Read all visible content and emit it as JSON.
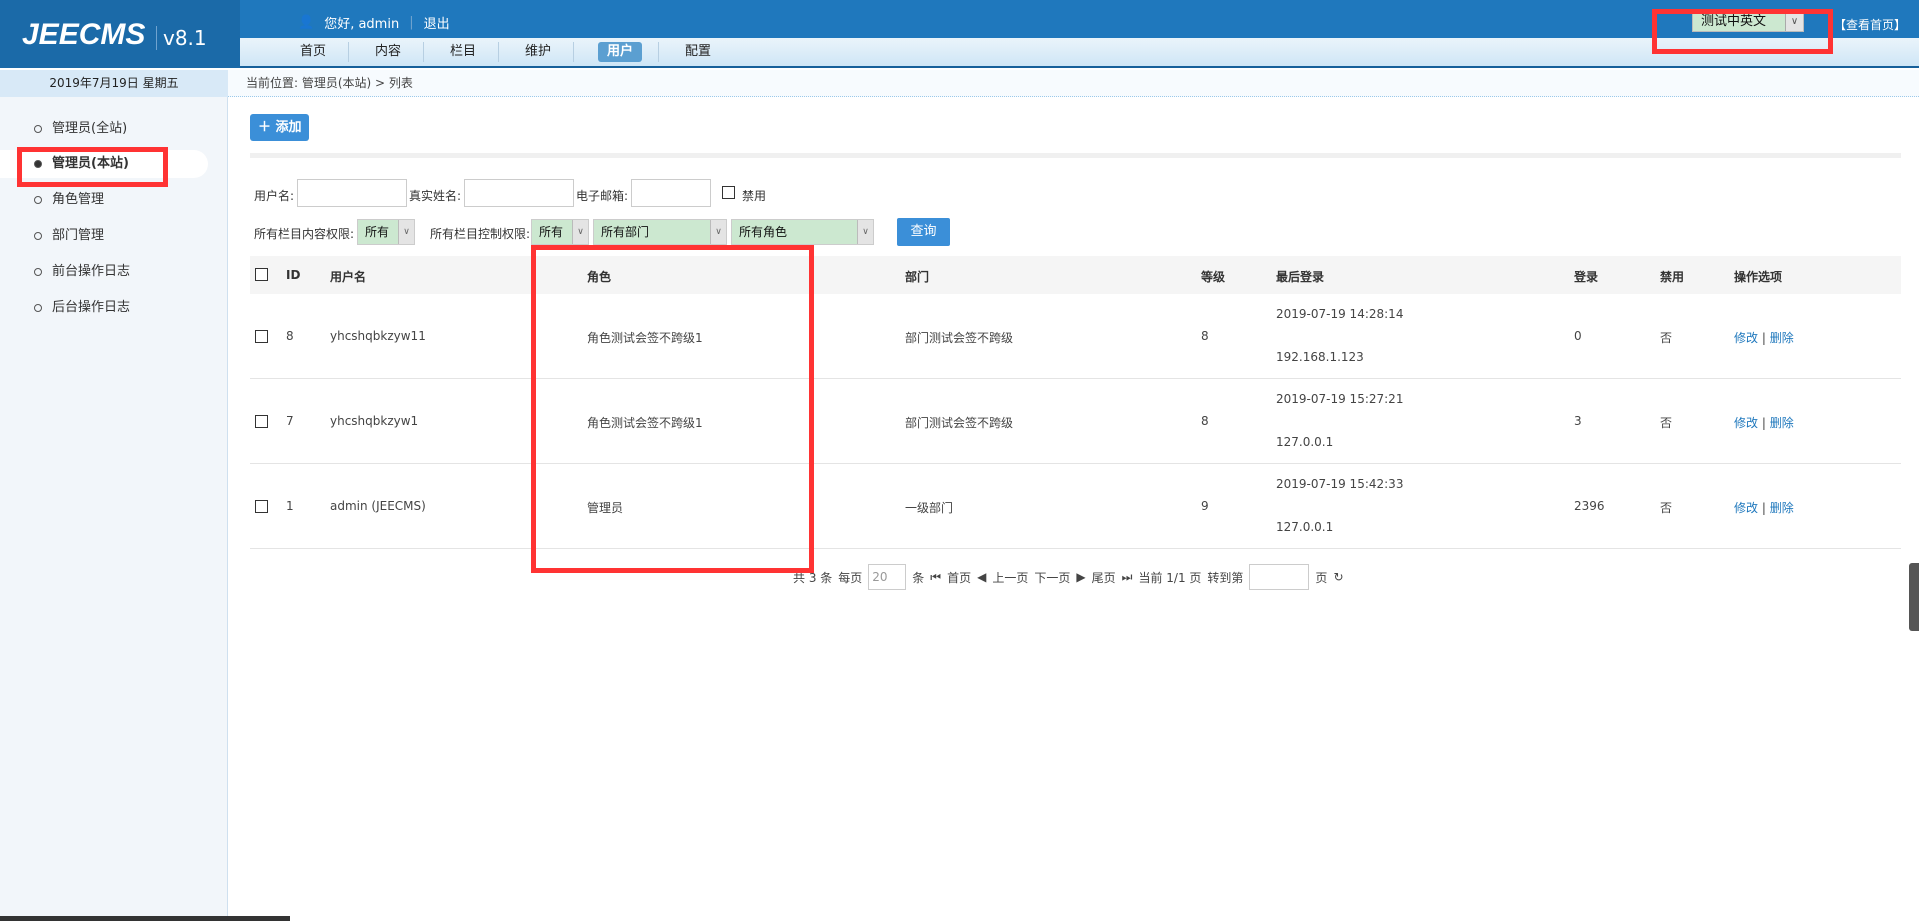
{
  "header": {
    "logo": "JEECMS",
    "version": "v8.1",
    "welcome": "您好, admin",
    "logout": "退出",
    "nav": [
      "首页",
      "内容",
      "栏目",
      "维护",
      "用户",
      "配置"
    ],
    "active_nav": "用户",
    "site_select": "测试中英文",
    "view_home": "【查看首页】"
  },
  "date": "2019年7月19日 星期五",
  "breadcrumb": "当前位置: 管理员(本站) > 列表",
  "sidebar": {
    "items": [
      {
        "label": "管理员(全站)"
      },
      {
        "label": "管理员(本站)",
        "active": true
      },
      {
        "label": "角色管理"
      },
      {
        "label": "部门管理"
      },
      {
        "label": "前台操作日志"
      },
      {
        "label": "后台操作日志"
      }
    ]
  },
  "toolbar": {
    "add": "添加"
  },
  "filters": {
    "username": "用户名:",
    "realname": "真实姓名:",
    "email": "电子邮箱:",
    "disabled": "禁用",
    "content_perm": "所有栏目内容权限:",
    "content_perm_value": "所有",
    "control_perm": "所有栏目控制权限:",
    "control_perm_value": "所有",
    "dept": "所有部门",
    "role": "所有角色",
    "query": "查询"
  },
  "table": {
    "headers": [
      "ID",
      "用户名",
      "角色",
      "部门",
      "等级",
      "最后登录",
      "登录",
      "禁用",
      "操作选项"
    ],
    "rows": [
      {
        "id": "8",
        "username": "yhcshqbkzyw11",
        "role": "角色测试会签不跨级1",
        "dept": "部门测试会签不跨级",
        "level": "8",
        "last_time": "2019-07-19 14:28:14",
        "last_ip": "192.168.1.123",
        "logins": "0",
        "disabled": "否"
      },
      {
        "id": "7",
        "username": "yhcshqbkzyw1",
        "role": "角色测试会签不跨级1",
        "dept": "部门测试会签不跨级",
        "level": "8",
        "last_time": "2019-07-19 15:27:21",
        "last_ip": "127.0.0.1",
        "logins": "3",
        "disabled": "否"
      },
      {
        "id": "1",
        "username": "admin (JEECMS)",
        "role": "管理员",
        "dept": "一级部门",
        "level": "9",
        "last_time": "2019-07-19 15:42:33",
        "last_ip": "127.0.0.1",
        "logins": "2396",
        "disabled": "否"
      }
    ],
    "edit": "修改",
    "sep": "|",
    "delete": "删除"
  },
  "pager": {
    "total": "共 3 条",
    "per_page_label": "每页",
    "per_page": "20",
    "unit": "条",
    "first": "首页",
    "prev": "上一页",
    "next": "下一页",
    "last": "尾页",
    "current": "当前 1/1 页",
    "goto": "转到第",
    "page": "页"
  }
}
